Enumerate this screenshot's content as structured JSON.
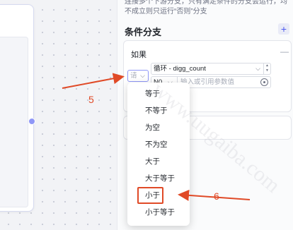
{
  "panel": {
    "description": "连接多个下游分支，只有满足条件的分支会运行，均不成立则只运行“否则”分支",
    "section_title": "条件分支",
    "add_icon": "plus-icon",
    "branch_if": {
      "label": "如果",
      "collapse_icon": "minus-icon",
      "operator_value": "请",
      "left_value": "循环 - digg_count",
      "right_type": "N0",
      "right_placeholder": "输入或引用参数值"
    }
  },
  "dropdown": {
    "items": [
      "等于",
      "不等于",
      "为空",
      "不为空",
      "大于",
      "大于等于",
      "小于",
      "小于等于"
    ],
    "highlighted": "小于"
  },
  "annotations": {
    "step5": "5",
    "step6": "6",
    "color": "#e04a27"
  },
  "watermark": "www.uugaiba.com"
}
